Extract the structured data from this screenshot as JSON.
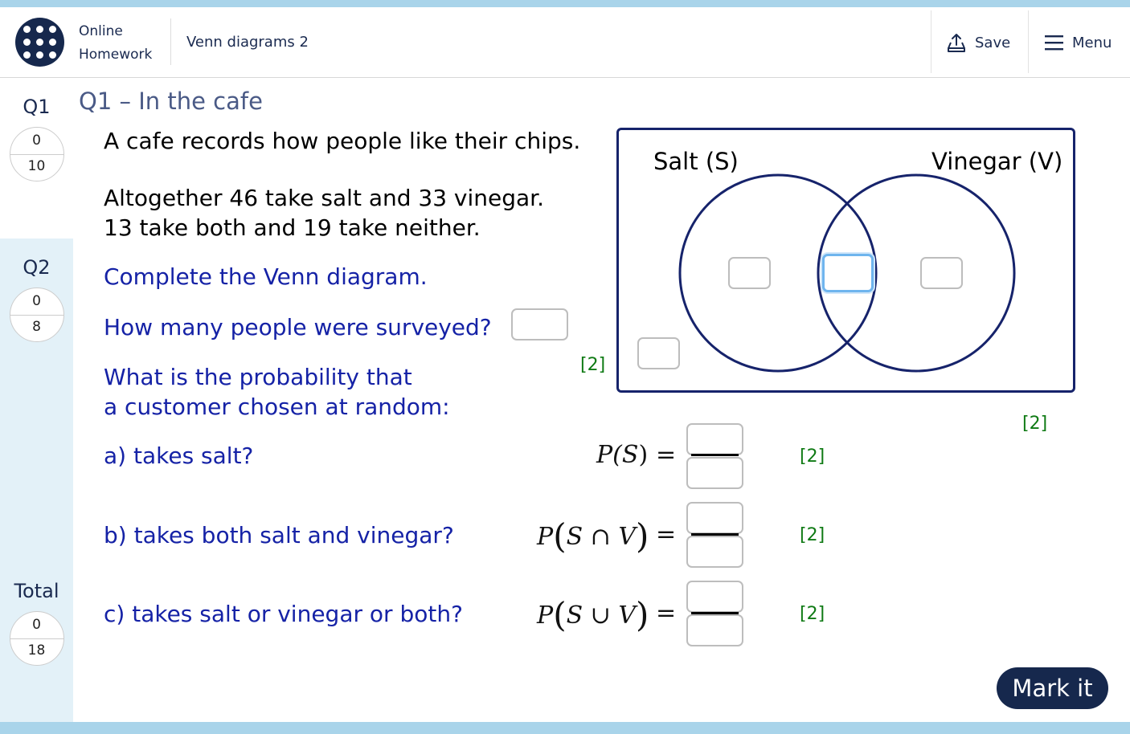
{
  "header": {
    "app_title_line1": "Online",
    "app_title_line2": "Homework",
    "activity_title": "Venn diagrams 2",
    "save_label": "Save",
    "menu_label": "Menu"
  },
  "sidebar": {
    "tabs": [
      {
        "label": "Q1",
        "score": "0",
        "max": "10",
        "active": true
      },
      {
        "label": "Q2",
        "score": "0",
        "max": "8",
        "active": false
      }
    ],
    "total": {
      "label": "Total",
      "score": "0",
      "max": "18"
    }
  },
  "question": {
    "title": "Q1 – In the cafe",
    "intro": "A cafe records how people like their chips.",
    "info_line1": "Altogether 46 take salt and 33 vinegar.",
    "info_line2": "13 take both and 19 take neither.",
    "instruction": "Complete the Venn diagram.",
    "surveyed_prompt": "How many people were surveyed?",
    "surveyed_marks": "[2]",
    "venn_marks": "[2]",
    "probability_intro_line1": "What is the probability that",
    "probability_intro_line2": "a customer chosen at random:",
    "parts": [
      {
        "label": "a) takes salt?",
        "expr_prefix": "P(",
        "expr_inner": "S",
        "expr_suffix": ")",
        "equals": "=",
        "marks": "[2]"
      },
      {
        "label": "b) takes both salt and vinegar?",
        "expr_prefix": "P",
        "expr_inner": "S ∩ V",
        "expr_suffix": "",
        "equals": "=",
        "marks": "[2]"
      },
      {
        "label": "c) takes salt or vinegar or both?",
        "expr_prefix": "P",
        "expr_inner": "S ∪ V",
        "expr_suffix": "",
        "equals": "=",
        "marks": "[2]"
      }
    ]
  },
  "venn": {
    "set_a_label": "Salt (S)",
    "set_b_label": "Vinegar (V)",
    "outline_color": "#16236b"
  },
  "actions": {
    "mark_it_label": "Mark it"
  },
  "colors": {
    "navy": "#16284d",
    "question_blue": "#1522a6",
    "marks_green": "#0f7a14",
    "focus_blue": "#6fb5ee",
    "sidebar_bg": "#e3f1f8"
  }
}
